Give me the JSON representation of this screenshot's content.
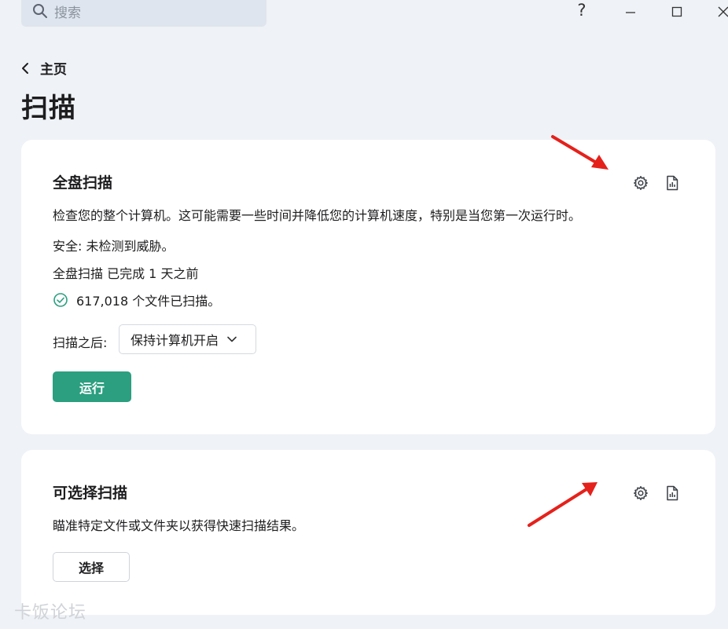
{
  "search": {
    "placeholder": "搜索"
  },
  "window": {
    "help_label": "?"
  },
  "nav": {
    "back_label": "主页"
  },
  "page": {
    "title": "扫描"
  },
  "full_scan": {
    "title": "全盘扫描",
    "description": "检查您的整个计算机。这可能需要一些时间并降低您的计算机速度，特别是当您第一次运行时。",
    "security_status": "安全: 未检测到威胁。",
    "last_run": "全盘扫描 已完成 1 天之前",
    "files_scanned": "617,018 个文件已扫描。",
    "after_scan_label": "扫描之后:",
    "after_scan_value": "保持计算机开启",
    "run_label": "运行"
  },
  "selective_scan": {
    "title": "可选择扫描",
    "description": "瞄准特定文件或文件夹以获得快速扫描结果。",
    "select_label": "选择"
  },
  "watermark": "卡饭论坛",
  "colors": {
    "accent": "#2b9f7f",
    "annotation_arrow": "#e5211b",
    "background": "#eff2f6"
  }
}
